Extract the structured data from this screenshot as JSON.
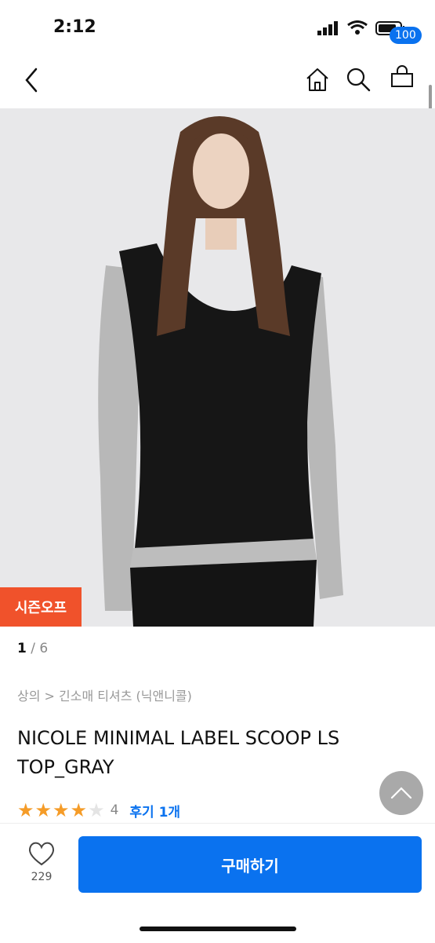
{
  "status_bar": {
    "time": "2:12"
  },
  "nav": {
    "cart_count": "100"
  },
  "product": {
    "sale_badge": "시즌오프",
    "image_index": "1",
    "image_total": "/ 6",
    "breadcrumb": "상의 > 긴소매 티셔츠 (닉앤니콜)",
    "title": "NICOLE MINIMAL LABEL SCOOP LS TOP_GRAY",
    "rating": 4,
    "rating_text": "4",
    "review_label": "후기 1개"
  },
  "bottom_bar": {
    "like_count": "229",
    "buy_label": "구매하기"
  },
  "colors": {
    "accent": "#0a72ef",
    "sale": "#f0522b",
    "star": "#f59c28"
  }
}
